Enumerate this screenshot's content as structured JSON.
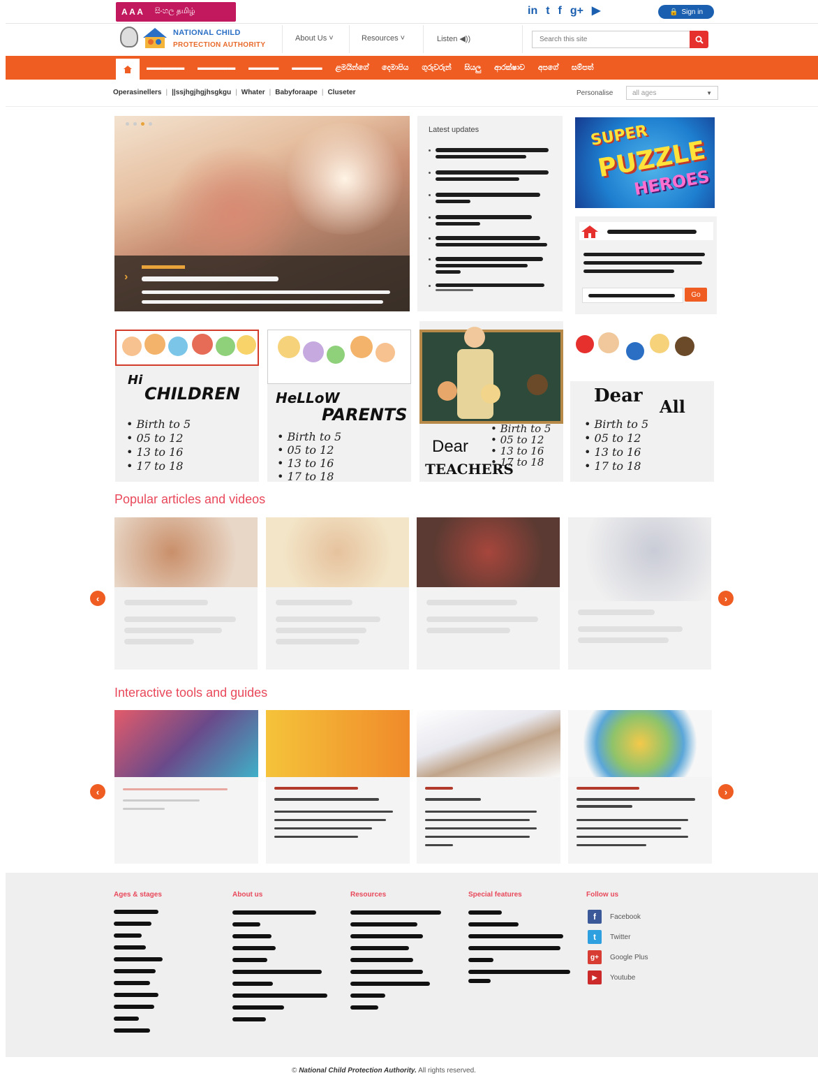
{
  "top_bar": {
    "font_sizes": "A A A",
    "languages": "සිංහල  தமிழ்",
    "social_icons": [
      "linkedin-icon",
      "twitter-icon",
      "facebook-icon",
      "google-plus-icon",
      "youtube-icon"
    ],
    "signin_label": "Sign in"
  },
  "header": {
    "org_line1": "NATIONAL CHILD",
    "org_line2": "PROTECTION AUTHORITY",
    "nav": [
      "About Us ˅",
      "Resources ˅",
      "Listen ◀))"
    ],
    "search_placeholder": "Search this site"
  },
  "main_nav": {
    "home_icon": "home-icon",
    "items": [
      "▬▬▬▬▬",
      "▬▬▬▬▬",
      "▬▬▬▬",
      "▬▬▬▬",
      "ළමයින්ගේ",
      "දෙමාපිය",
      "ගුරුවරුන්",
      "සියලු",
      "ආරක්ෂාව",
      "අපගේ",
      "සම්පත්"
    ]
  },
  "sub_nav": {
    "items": [
      "Operasinellers",
      "||ssjhgjhgjhsgkgu",
      "Whater",
      "Babyforaape",
      "Cluseter"
    ],
    "personalise_label": "Personalise",
    "ages_value": "all ages"
  },
  "hero": {
    "active_dot": 2,
    "dots": 4
  },
  "latest_updates": {
    "title": "Latest updates",
    "items": 7
  },
  "puzzle": {
    "line1": "SUPER",
    "line2": "PUZZLE",
    "line3": "HEROES"
  },
  "promo": {
    "go_label": "Go"
  },
  "audience_cards": [
    {
      "title_a": "Hi",
      "title_b": "CHILDREN",
      "ages": [
        "Birth to 5",
        "05  to 12",
        "13  to 16",
        "17  to 18"
      ]
    },
    {
      "title_a": "HeLLoW",
      "title_b": "PARENTS",
      "ages": [
        "Birth to 5",
        "05  to 12",
        "13  to 16",
        "17  to 18"
      ]
    },
    {
      "title_a": "Dear",
      "title_b": "TEACHERS",
      "ages": [
        "Birth to 5",
        "05  to 12",
        "13  to 16",
        "17  to 18"
      ]
    },
    {
      "title_a": "Dear",
      "title_b": "All",
      "ages": [
        "Birth to 5",
        "05  to 12",
        "13  to 16",
        "17  to 18"
      ]
    }
  ],
  "sections": {
    "popular": "Popular articles and videos",
    "tools": "Interactive tools and guides"
  },
  "footer": {
    "columns": [
      "Ages & stages",
      "About us",
      "Resources",
      "Special features",
      "Follow us"
    ],
    "follow": [
      {
        "icon": "facebook-icon",
        "label": "Facebook",
        "glyph": "f",
        "color": "#3b5998"
      },
      {
        "icon": "twitter-icon",
        "label": "Twitter",
        "glyph": "t",
        "color": "#2ea0e0"
      },
      {
        "icon": "google-plus-icon",
        "label": "Google Plus",
        "glyph": "g+",
        "color": "#d73d32"
      },
      {
        "icon": "youtube-icon",
        "label": "Youtube",
        "glyph": "▶",
        "color": "#cc2a2a"
      }
    ],
    "copyright_sym": "©",
    "copyright_org": "National Child Protection Authority.",
    "copyright_rest": "All rights reserved."
  },
  "colors": {
    "accent": "#ef5d23",
    "brand_blue": "#1b5fb0",
    "section_title": "#e8485a",
    "lang_bar": "#c2195e"
  }
}
